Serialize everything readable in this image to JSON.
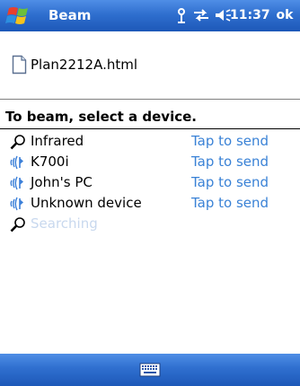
{
  "titlebar": {
    "title": "Beam",
    "clock": "11:37",
    "ok_label": "ok",
    "icons": [
      "start-flag-icon",
      "antenna-icon",
      "connectivity-icon",
      "volume-icon"
    ]
  },
  "file": {
    "name": "Plan2212A.html",
    "icon": "document-icon"
  },
  "instruction": "To beam, select a device.",
  "devices": [
    {
      "name": "Infrared",
      "action": "Tap to send",
      "icon": "search-icon"
    },
    {
      "name": "K700i",
      "action": "Tap to send",
      "icon": "bluetooth-icon"
    },
    {
      "name": "John's PC",
      "action": "Tap to send",
      "icon": "bluetooth-icon"
    },
    {
      "name": "Unknown device",
      "action": "Tap to send",
      "icon": "bluetooth-icon"
    },
    {
      "name": "Searching",
      "action": "",
      "icon": "search-icon"
    }
  ],
  "bottombar": {
    "icon": "keyboard-icon"
  },
  "colors": {
    "titlebar_blue": "#2f6fcf",
    "link_blue": "#3a82d6",
    "searching_text": "#c8d8ee"
  }
}
